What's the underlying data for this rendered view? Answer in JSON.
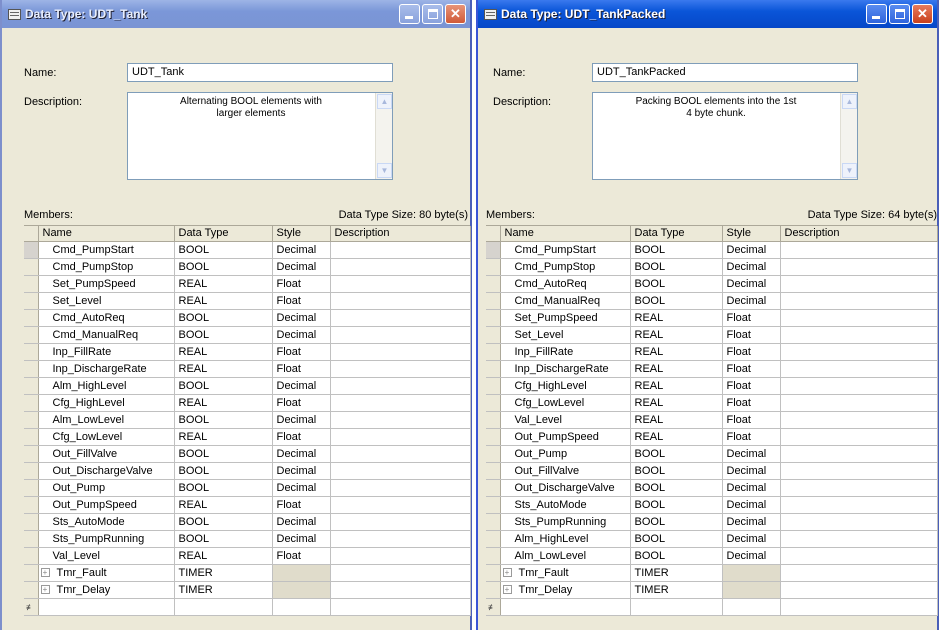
{
  "common": {
    "name_label": "Name:",
    "description_label": "Description:",
    "members_label": "Members:",
    "columns": [
      "Name",
      "Data Type",
      "Style",
      "Description"
    ],
    "new_row_icon": "new-row-icon"
  },
  "left": {
    "title": "Data Type:  UDT_Tank",
    "name_value": "UDT_Tank",
    "description": "Alternating BOOL elements with larger elements",
    "size_text": "Data Type Size: 80 byte(s)",
    "members": [
      {
        "name": "Cmd_PumpStart",
        "type": "BOOL",
        "style": "Decimal"
      },
      {
        "name": "Cmd_PumpStop",
        "type": "BOOL",
        "style": "Decimal"
      },
      {
        "name": "Set_PumpSpeed",
        "type": "REAL",
        "style": "Float"
      },
      {
        "name": "Set_Level",
        "type": "REAL",
        "style": "Float"
      },
      {
        "name": "Cmd_AutoReq",
        "type": "BOOL",
        "style": "Decimal"
      },
      {
        "name": "Cmd_ManualReq",
        "type": "BOOL",
        "style": "Decimal"
      },
      {
        "name": "Inp_FillRate",
        "type": "REAL",
        "style": "Float"
      },
      {
        "name": "Inp_DischargeRate",
        "type": "REAL",
        "style": "Float"
      },
      {
        "name": "Alm_HighLevel",
        "type": "BOOL",
        "style": "Decimal"
      },
      {
        "name": "Cfg_HighLevel",
        "type": "REAL",
        "style": "Float"
      },
      {
        "name": "Alm_LowLevel",
        "type": "BOOL",
        "style": "Decimal"
      },
      {
        "name": "Cfg_LowLevel",
        "type": "REAL",
        "style": "Float"
      },
      {
        "name": "Out_FillValve",
        "type": "BOOL",
        "style": "Decimal"
      },
      {
        "name": "Out_DischargeValve",
        "type": "BOOL",
        "style": "Decimal"
      },
      {
        "name": "Out_Pump",
        "type": "BOOL",
        "style": "Decimal"
      },
      {
        "name": "Out_PumpSpeed",
        "type": "REAL",
        "style": "Float"
      },
      {
        "name": "Sts_AutoMode",
        "type": "BOOL",
        "style": "Decimal"
      },
      {
        "name": "Sts_PumpRunning",
        "type": "BOOL",
        "style": "Decimal"
      },
      {
        "name": "Val_Level",
        "type": "REAL",
        "style": "Float"
      },
      {
        "name": "Tmr_Fault",
        "type": "TIMER",
        "style": "",
        "expandable": true
      },
      {
        "name": "Tmr_Delay",
        "type": "TIMER",
        "style": "",
        "expandable": true
      }
    ]
  },
  "right": {
    "title": "Data Type:  UDT_TankPacked",
    "name_value": "UDT_TankPacked",
    "description": "Packing BOOL elements into the 1st 4 byte chunk.",
    "size_text": "Data Type Size: 64 byte(s)",
    "members": [
      {
        "name": "Cmd_PumpStart",
        "type": "BOOL",
        "style": "Decimal"
      },
      {
        "name": "Cmd_PumpStop",
        "type": "BOOL",
        "style": "Decimal"
      },
      {
        "name": "Cmd_AutoReq",
        "type": "BOOL",
        "style": "Decimal"
      },
      {
        "name": "Cmd_ManualReq",
        "type": "BOOL",
        "style": "Decimal"
      },
      {
        "name": "Set_PumpSpeed",
        "type": "REAL",
        "style": "Float"
      },
      {
        "name": "Set_Level",
        "type": "REAL",
        "style": "Float"
      },
      {
        "name": "Inp_FillRate",
        "type": "REAL",
        "style": "Float"
      },
      {
        "name": "Inp_DischargeRate",
        "type": "REAL",
        "style": "Float"
      },
      {
        "name": "Cfg_HighLevel",
        "type": "REAL",
        "style": "Float"
      },
      {
        "name": "Cfg_LowLevel",
        "type": "REAL",
        "style": "Float"
      },
      {
        "name": "Val_Level",
        "type": "REAL",
        "style": "Float"
      },
      {
        "name": "Out_PumpSpeed",
        "type": "REAL",
        "style": "Float"
      },
      {
        "name": "Out_Pump",
        "type": "BOOL",
        "style": "Decimal"
      },
      {
        "name": "Out_FillValve",
        "type": "BOOL",
        "style": "Decimal"
      },
      {
        "name": "Out_DischargeValve",
        "type": "BOOL",
        "style": "Decimal"
      },
      {
        "name": "Sts_AutoMode",
        "type": "BOOL",
        "style": "Decimal"
      },
      {
        "name": "Sts_PumpRunning",
        "type": "BOOL",
        "style": "Decimal"
      },
      {
        "name": "Alm_HighLevel",
        "type": "BOOL",
        "style": "Decimal"
      },
      {
        "name": "Alm_LowLevel",
        "type": "BOOL",
        "style": "Decimal"
      },
      {
        "name": "Tmr_Fault",
        "type": "TIMER",
        "style": "",
        "expandable": true
      },
      {
        "name": "Tmr_Delay",
        "type": "TIMER",
        "style": "",
        "expandable": true
      }
    ]
  }
}
